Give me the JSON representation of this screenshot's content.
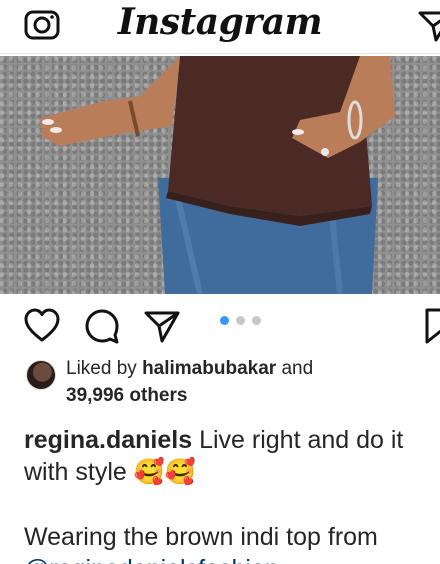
{
  "header": {
    "logo_text": "Instagram",
    "left_icon": "camera-icon",
    "right_icon": "direct-message-icon"
  },
  "post": {
    "media_description_icons": [
      "heart-icon",
      "comment-icon",
      "share-icon",
      "bookmark-icon"
    ],
    "carousel": {
      "count": 3,
      "active_index": 0,
      "active_color": "#3897f0",
      "inactive_color": "#c7c7c7"
    },
    "likes": {
      "prefix": "Liked by",
      "liker": "halimabubakar",
      "connector": "and",
      "others": "39,996 others"
    },
    "caption": {
      "username": "regina.daniels",
      "text": " Live right and do it with style 🥰🥰",
      "line2": "Wearing the brown indi top from",
      "line3": "@reginadanielsfashion"
    }
  },
  "colors": {
    "text": "#262626",
    "link": "#00376b",
    "divider": "#e6e6e6"
  }
}
